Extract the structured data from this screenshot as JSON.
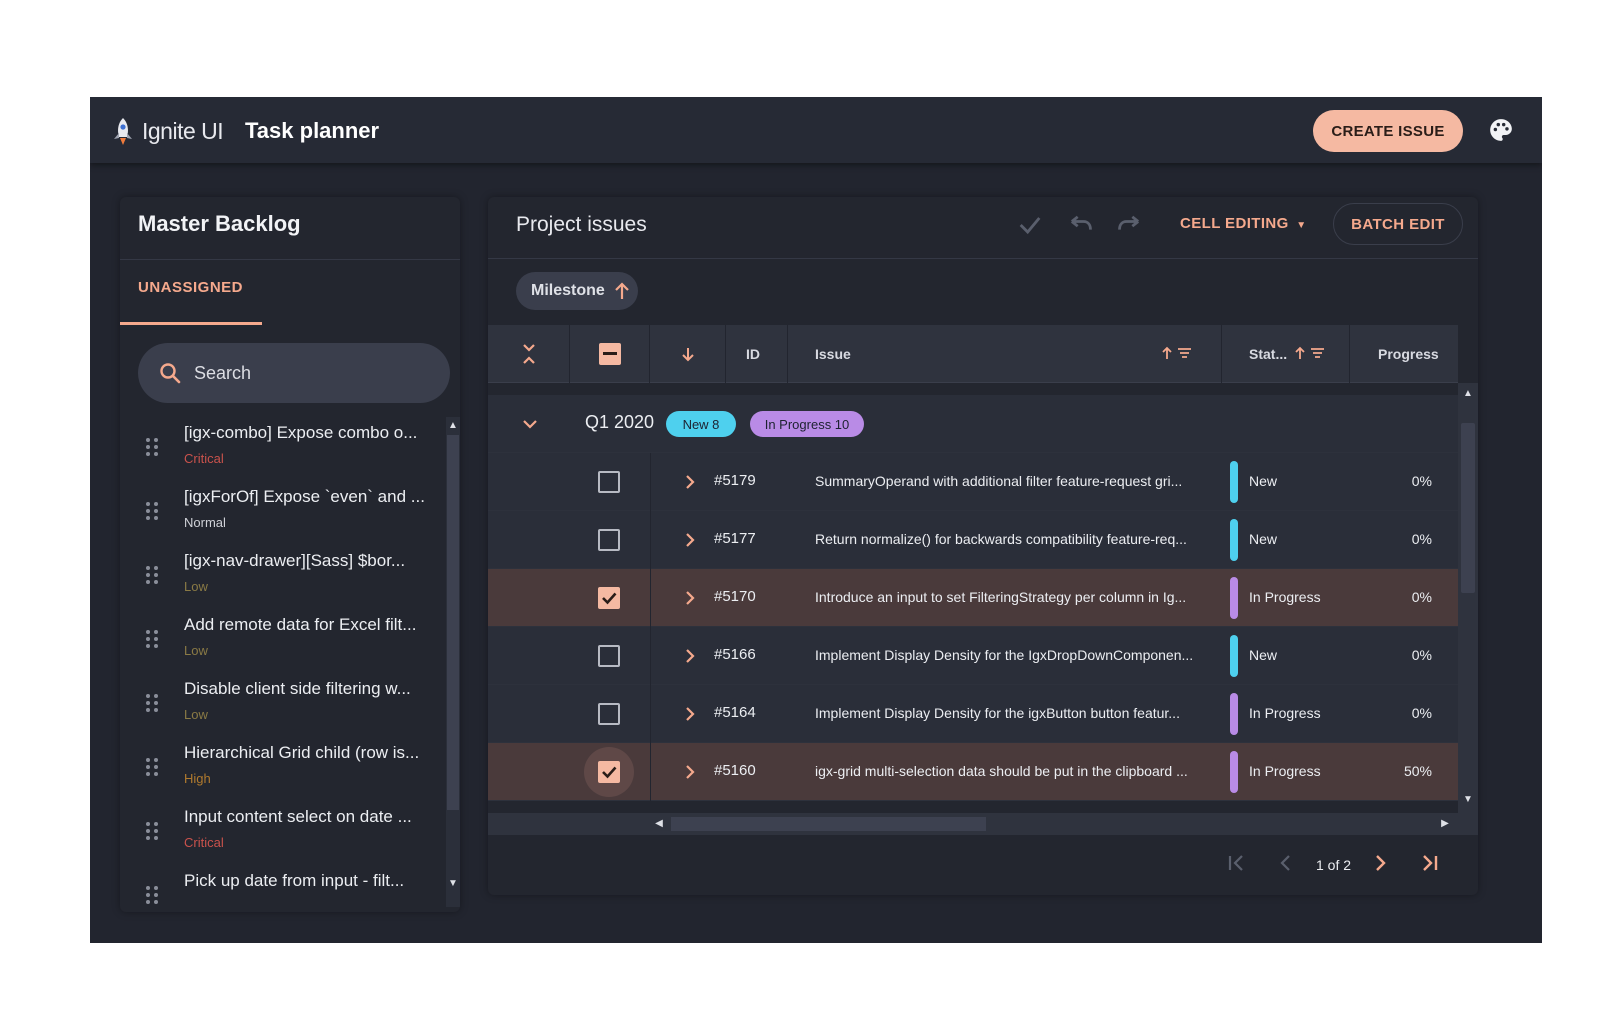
{
  "header": {
    "logo_text": "Ignite UI",
    "app_title": "Task planner",
    "create_label": "CREATE ISSUE",
    "palette_icon": "palette-icon"
  },
  "sidebar": {
    "title": "Master Backlog",
    "tab": "UNASSIGNED",
    "search_placeholder": "Search",
    "items": [
      {
        "title": "[igx-combo] Expose combo o...",
        "priority": "Critical",
        "color": "#c9524c"
      },
      {
        "title": "[igxForOf] Expose `even` and ...",
        "priority": "Normal",
        "color": "#d0d2d8"
      },
      {
        "title": "[igx-nav-drawer][Sass] $bor...",
        "priority": "Low",
        "color": "#8a7a45"
      },
      {
        "title": "Add remote data for Excel filt...",
        "priority": "Low",
        "color": "#8a7a45"
      },
      {
        "title": "Disable client side filtering w...",
        "priority": "Low",
        "color": "#8a7a45"
      },
      {
        "title": "Hierarchical Grid child (row is...",
        "priority": "High",
        "color": "#b07a2e"
      },
      {
        "title": "Input content select on date ...",
        "priority": "Critical",
        "color": "#c9524c"
      },
      {
        "title": "Pick up date from input - filt...",
        "priority": "",
        "color": "#8a7a45"
      }
    ]
  },
  "main": {
    "title": "Project issues",
    "cell_editing_label": "CELL EDITING",
    "batch_edit_label": "BATCH EDIT",
    "group_chip": "Milestone",
    "columns": {
      "id": "ID",
      "issue": "Issue",
      "status": "Stat...",
      "progress": "Progress"
    },
    "group": {
      "label": "Q1 2020",
      "new_badge": "New 8",
      "progress_badge": "In Progress 10"
    },
    "rows": [
      {
        "id": "#5179",
        "issue": "SummaryOperand with additional filter feature-request gri...",
        "status": "New",
        "progress": "0%",
        "selected": false,
        "bar": "#4ed0ee"
      },
      {
        "id": "#5177",
        "issue": "Return normalize() for backwards compatibility feature-req...",
        "status": "New",
        "progress": "0%",
        "selected": false,
        "bar": "#4ed0ee"
      },
      {
        "id": "#5170",
        "issue": "Introduce an input to set FilteringStrategy per column in Ig...",
        "status": "In Progress",
        "progress": "0%",
        "selected": true,
        "bar": "#b98be6"
      },
      {
        "id": "#5166",
        "issue": "Implement Display Density for the IgxDropDownComponen...",
        "status": "New",
        "progress": "0%",
        "selected": false,
        "bar": "#4ed0ee"
      },
      {
        "id": "#5164",
        "issue": "Implement Display Density for the igxButton button featur...",
        "status": "In Progress",
        "progress": "0%",
        "selected": false,
        "bar": "#b98be6"
      },
      {
        "id": "#5160",
        "issue": "igx-grid multi-selection data should be put in the clipboard ...",
        "status": "In Progress",
        "progress": "50%",
        "selected": true,
        "bar": "#b98be6"
      }
    ],
    "pager": "1 of 2"
  },
  "colors": {
    "accent": "#f5a98d",
    "new": "#4ed0ee",
    "in_progress": "#b98be6"
  }
}
